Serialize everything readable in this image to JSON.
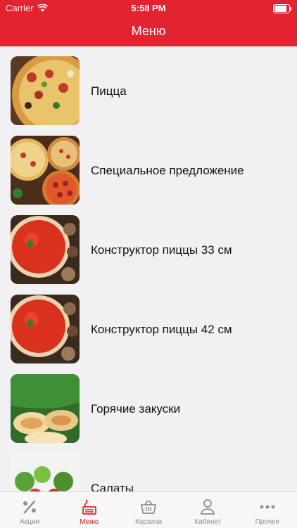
{
  "status_bar": {
    "carrier": "Carrier",
    "time": "5:58 PM",
    "battery_level": 0.9
  },
  "nav": {
    "title": "Меню"
  },
  "menu_items": [
    {
      "label": "Пицца"
    },
    {
      "label": "Специальное предложение"
    },
    {
      "label": "Конструктор пиццы 33 см"
    },
    {
      "label": "Конструктор пиццы 42 см"
    },
    {
      "label": "Горячие закуски"
    },
    {
      "label": "Салаты"
    }
  ],
  "tabs": [
    {
      "label": "Акции",
      "icon": "percent-icon"
    },
    {
      "label": "Меню",
      "icon": "menu-icon"
    },
    {
      "label": "Корзина",
      "icon": "basket-icon"
    },
    {
      "label": "Кабинет",
      "icon": "person-icon"
    },
    {
      "label": "Прочее",
      "icon": "more-icon"
    }
  ],
  "active_tab": "Меню",
  "colors": {
    "accent": "#e3232f",
    "inactive": "#8e8e93",
    "background": "#f1f1f3"
  }
}
